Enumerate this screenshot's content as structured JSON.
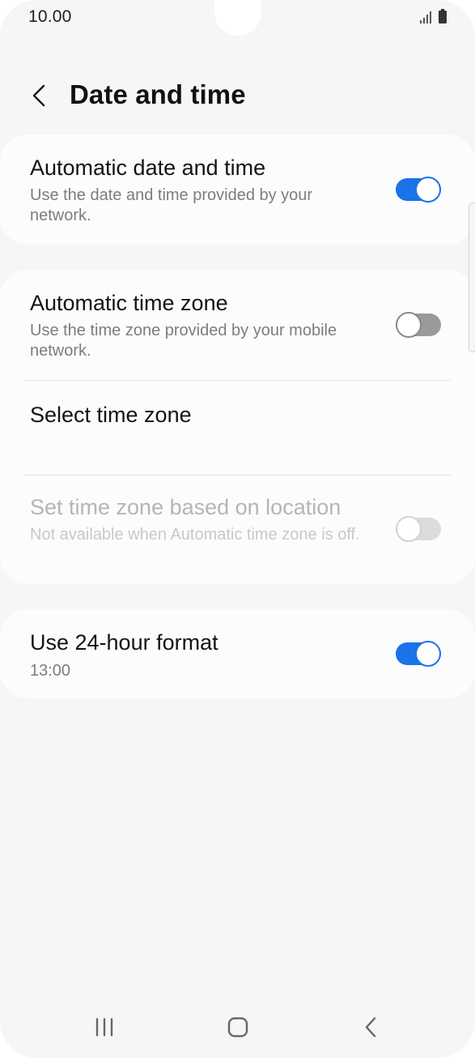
{
  "status_bar": {
    "time": "10.00",
    "icons": [
      "signal-icon",
      "battery-icon"
    ]
  },
  "header": {
    "back_icon": "chevron-left-icon",
    "title": "Date and time"
  },
  "settings": {
    "automatic_date_time": {
      "title": "Automatic date and time",
      "subtitle": "Use the date and time provided by your network.",
      "enabled": true
    },
    "automatic_time_zone": {
      "title": "Automatic time zone",
      "subtitle": "Use the time zone provided by your mobile network.",
      "enabled": false
    },
    "select_time_zone": {
      "title": "Select time zone"
    },
    "location_time_zone": {
      "title": "Set time zone based on location",
      "subtitle": "Not available when Automatic time zone is off.",
      "enabled": false,
      "disabled": true
    },
    "use_24_hour": {
      "title": "Use 24-hour format",
      "subtitle": "13:00",
      "enabled": true
    }
  },
  "nav_bar": {
    "icons": [
      "recent-apps-icon",
      "home-icon",
      "back-icon"
    ]
  },
  "colors": {
    "accent": "#1a73e8",
    "background": "#f6f6f6",
    "card": "#fcfcfc"
  }
}
